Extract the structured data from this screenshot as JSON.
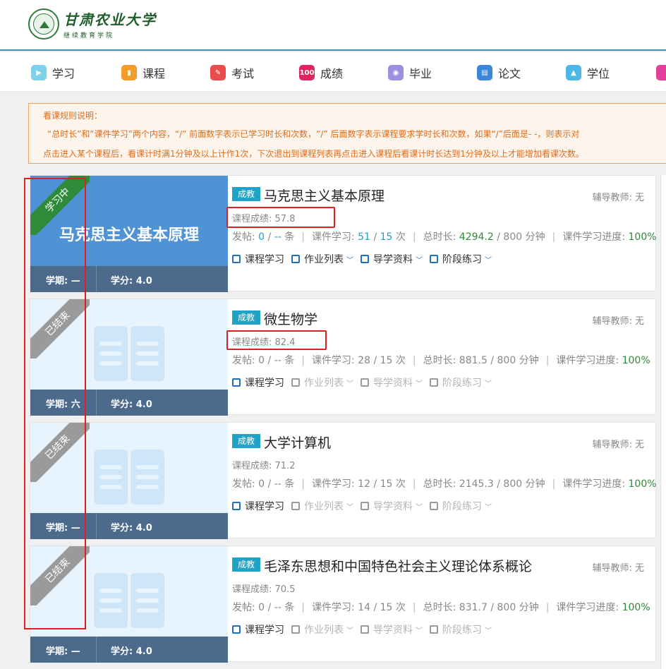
{
  "brand": {
    "name": "甘肃农业大学",
    "sub": "继续教育学院"
  },
  "nav": [
    {
      "label": "学习",
      "color": "#7fd0e8",
      "glyph": "▶"
    },
    {
      "label": "课程",
      "color": "#f39c2b",
      "glyph": "▮"
    },
    {
      "label": "考试",
      "color": "#e84c4c",
      "glyph": "✎"
    },
    {
      "label": "成绩",
      "color": "#e0245e",
      "glyph": "100"
    },
    {
      "label": "毕业",
      "color": "#9b8fe0",
      "glyph": "◉"
    },
    {
      "label": "论文",
      "color": "#3a86d8",
      "glyph": "▤"
    },
    {
      "label": "学位",
      "color": "#4db8e8",
      "glyph": "▲"
    },
    {
      "label": "",
      "color": "#e0409a",
      "glyph": ""
    }
  ],
  "notice": {
    "title": "看课规则说明：",
    "line1": "“总时长”和“课件学习”两个内容，“/” 前面数字表示已学习时长和次数，“/” 后面数字表示课程要求学时长和次数，如果“/”后面是- -，则表示对",
    "line2": "点击进入某个课程后，看课计时满1分钟及以上计作1次，下次退出到课程列表再点击进入课程后看课计时长达到1分钟及以上才能增加看课次数。"
  },
  "labels": {
    "tag": "成教",
    "tutor": "辅导教师: 无",
    "score_prefix": "课程成绩: ",
    "posts": "发帖: ",
    "courseware": "课件学习: ",
    "total": "总时长: ",
    "progress": "课件学习进度: ",
    "unit_tiao": " 条",
    "unit_ci": " 次",
    "unit_min": " 分钟",
    "act_study": "课程学习",
    "act_homework": "作业列表",
    "act_guide": "导学资料",
    "act_practice": "阶段练习"
  },
  "courses": [
    {
      "name": "马克思主义基本原理",
      "cover_title": "马克思主义基本原理",
      "status": "学习中",
      "term": "学期: —",
      "credit": "学分: 4.0",
      "score": "57.8",
      "posts_done": "0",
      "posts_req": "--",
      "cw_done": "51",
      "cw_req": "15",
      "time_done": "4294.2",
      "time_req": "800",
      "progress": "100%",
      "active": true
    },
    {
      "name": "微生物学",
      "cover_title": "",
      "status": "已结束",
      "term": "学期: 六",
      "credit": "学分: 4.0",
      "score": "82.4",
      "posts_done": "0",
      "posts_req": "--",
      "cw_done": "28",
      "cw_req": "15",
      "time_done": "881.5",
      "time_req": "800",
      "progress": "100%",
      "active": false
    },
    {
      "name": "大学计算机",
      "cover_title": "",
      "status": "已结束",
      "term": "学期: —",
      "credit": "学分: 4.0",
      "score": "71.2",
      "posts_done": "0",
      "posts_req": "--",
      "cw_done": "12",
      "cw_req": "15",
      "time_done": "2145.3",
      "time_req": "800",
      "progress": "100%",
      "active": false
    },
    {
      "name": "毛泽东思想和中国特色社会主义理论体系概论",
      "cover_title": "",
      "status": "已结束",
      "term": "学期: —",
      "credit": "学分: 4.0",
      "score": "70.5",
      "posts_done": "0",
      "posts_req": "--",
      "cw_done": "14",
      "cw_req": "15",
      "time_done": "831.7",
      "time_req": "800",
      "progress": "100%",
      "active": false
    }
  ]
}
